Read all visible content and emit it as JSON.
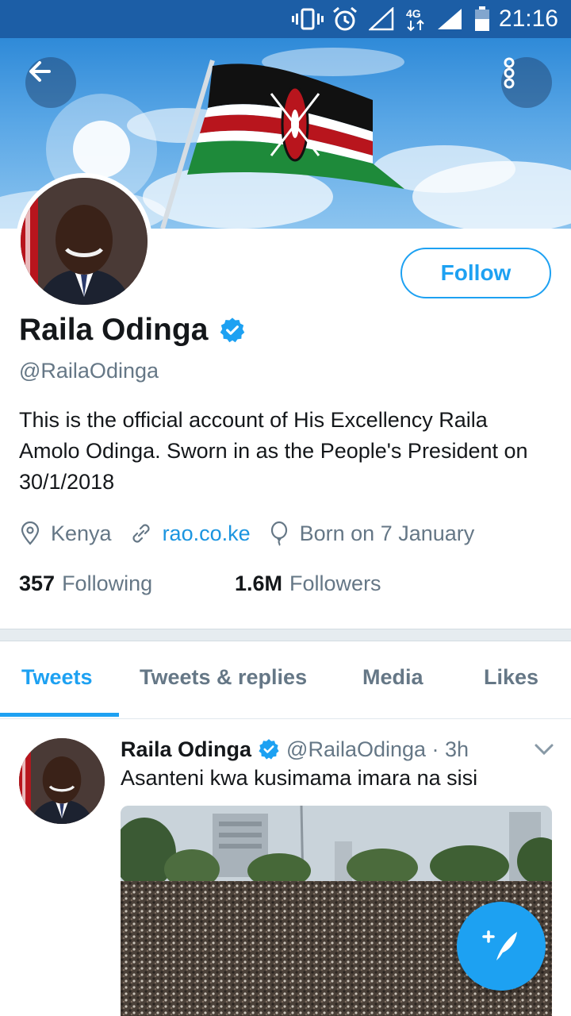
{
  "status_bar": {
    "time": "21:16",
    "network": "4G",
    "icons": [
      "vibrate-icon",
      "alarm-icon",
      "signal-icon",
      "network-4g-icon",
      "signal-full-icon",
      "battery-icon"
    ]
  },
  "header": {
    "back_icon": "arrow-left-icon",
    "more_icon": "more-vertical-icon",
    "banner": "kenyan-flag-banner"
  },
  "profile": {
    "name": "Raila Odinga",
    "handle": "@RailaOdinga",
    "verified": true,
    "follow_label": "Follow",
    "bio": "This is the official account of His Excellency Raila Amolo Odinga. Sworn in as the People's President on 30/1/2018",
    "location": "Kenya",
    "website": "rao.co.ke",
    "birthday": "Born on 7 January",
    "following_count": "357",
    "following_label": "Following",
    "followers_count": "1.6M",
    "followers_label": "Followers"
  },
  "tabs": [
    {
      "label": "Tweets",
      "active": true
    },
    {
      "label": "Tweets & replies",
      "active": false
    },
    {
      "label": "Media",
      "active": false
    },
    {
      "label": "Likes",
      "active": false
    }
  ],
  "tweet": {
    "name": "Raila Odinga",
    "handle": "@RailaOdinga · 3h",
    "text": "Asanteni kwa kusimama imara na sisi"
  },
  "colors": {
    "accent": "#1da1f2",
    "status_bar": "#1c5ea6",
    "secondary_text": "#657786",
    "link": "#1b95e0"
  },
  "compose_icon": "compose-tweet-icon"
}
